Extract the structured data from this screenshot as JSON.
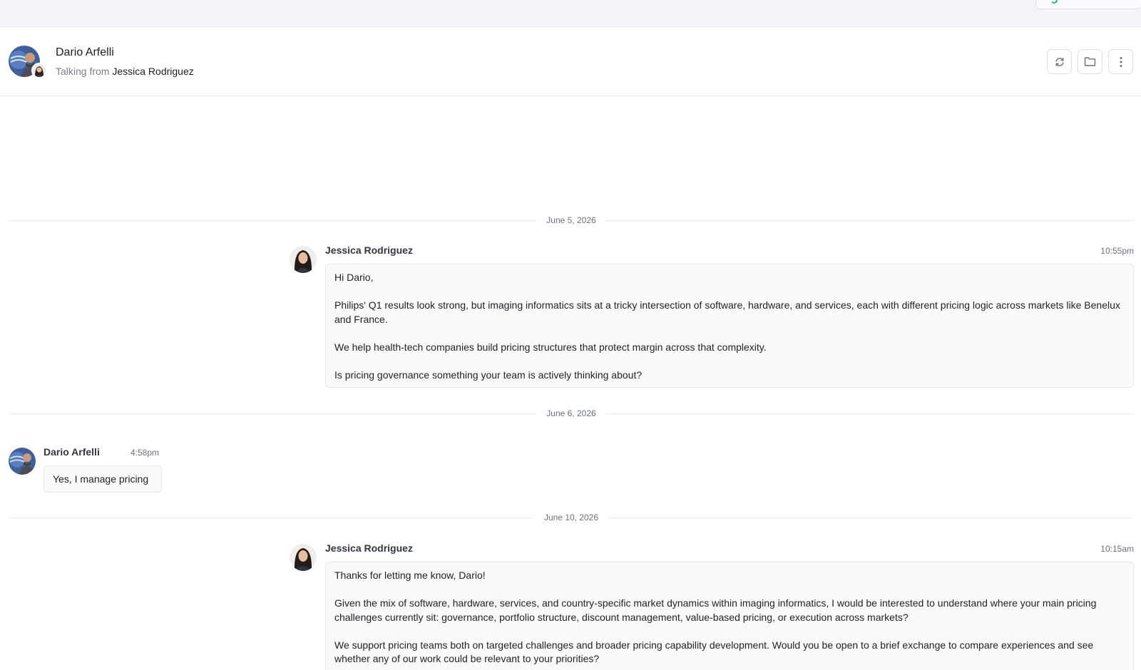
{
  "header": {
    "contact_name": "Dario Arfelli",
    "talking_from_label": "Talking from",
    "talking_from_name": "Jessica Rodriguez",
    "actions": [
      "refresh-icon",
      "folder-icon",
      "more-vertical-icon"
    ]
  },
  "thread": {
    "dates": [
      "June 5, 2026",
      "June 6, 2026",
      "June 10, 2026"
    ],
    "messages": [
      {
        "sender": "Jessica Rodriguez",
        "time": "10:55pm",
        "paragraphs": [
          "Hi Dario,",
          "Philips' Q1 results look strong, but imaging informatics sits at a tricky intersection of software, hardware, and services, each with different pricing logic across markets like Benelux and France.",
          "We help health-tech companies build pricing structures that protect margin across that complexity.",
          "Is pricing governance something your team is actively thinking about?"
        ]
      },
      {
        "sender": "Dario Arfelli",
        "time": "4:58pm",
        "paragraphs": [
          "Yes, I manage pricing"
        ]
      },
      {
        "sender": "Jessica Rodriguez",
        "time": "10:15am",
        "paragraphs": [
          "Thanks for letting me know, Dario!",
          "Given the mix of software, hardware, services, and country-specific market dynamics within imaging informatics, I would be interested to understand where your main pricing challenges currently sit: governance, portfolio structure, discount management, value-based pricing, or execution across markets?",
          "We support pricing teams both on targeted challenges and broader pricing capability development. Would you be open to a brief exchange to compare experiences and see whether any of our work could be relevant to your priorities?"
        ]
      }
    ]
  },
  "colors": {
    "topbar_bg": "#f3f5f8",
    "bubble_bg": "#fafafa",
    "accent_green": "#2bb673"
  }
}
